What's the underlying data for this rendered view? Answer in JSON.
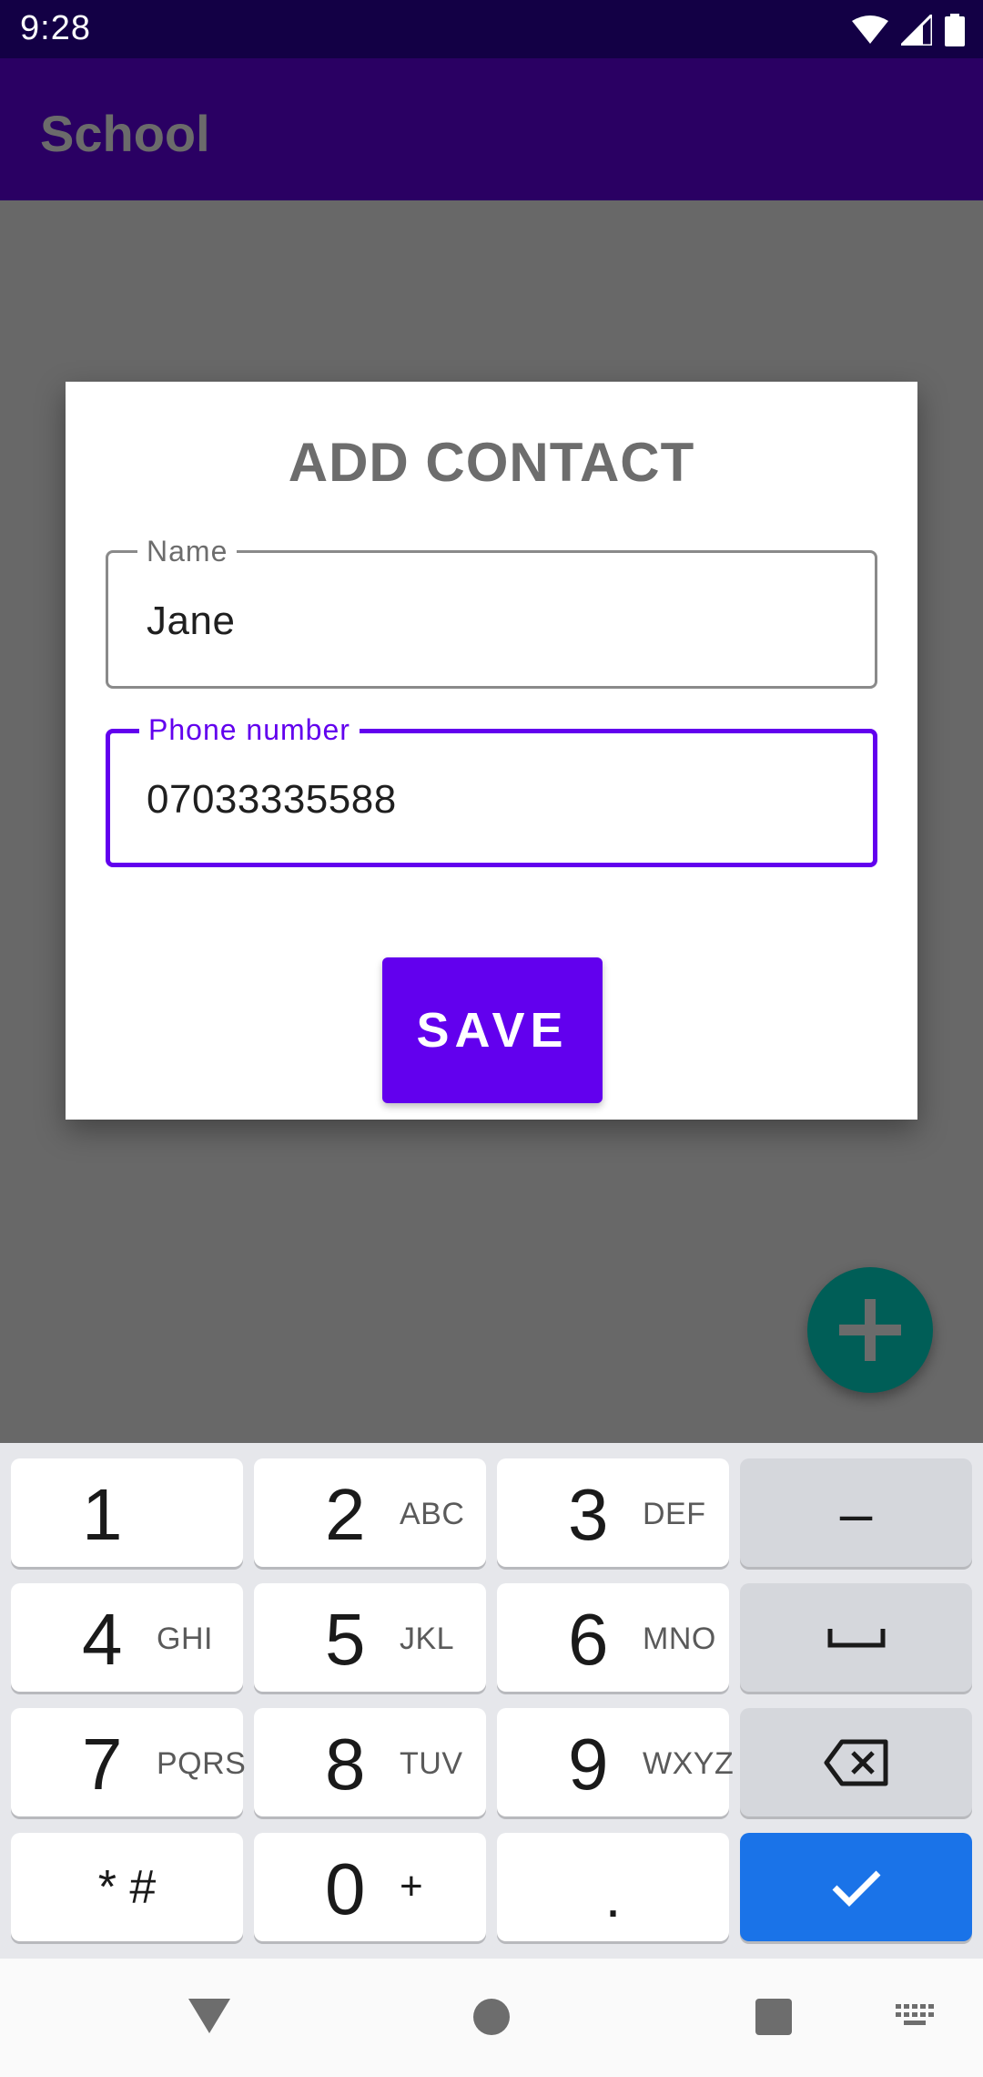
{
  "status_bar": {
    "time": "9:28",
    "icons": [
      "wifi-icon",
      "cell-signal-icon",
      "battery-icon"
    ]
  },
  "app_bar": {
    "title": "School"
  },
  "dialog": {
    "title": "ADD CONTACT",
    "name_field": {
      "label": "Name",
      "value": "Jane"
    },
    "phone_field": {
      "label": "Phone number",
      "value": "07033335588"
    },
    "save_label": "SAVE"
  },
  "fab": {
    "icon": "plus-icon"
  },
  "keyboard": {
    "rows": [
      [
        {
          "digit": "1",
          "letters": ""
        },
        {
          "digit": "2",
          "letters": "ABC"
        },
        {
          "digit": "3",
          "letters": "DEF"
        },
        {
          "symbol": "–"
        }
      ],
      [
        {
          "digit": "4",
          "letters": "GHI"
        },
        {
          "digit": "5",
          "letters": "JKL"
        },
        {
          "digit": "6",
          "letters": "MNO"
        },
        {
          "icon": "space-icon"
        }
      ],
      [
        {
          "digit": "7",
          "letters": "PQRS"
        },
        {
          "digit": "8",
          "letters": "TUV"
        },
        {
          "digit": "9",
          "letters": "WXYZ"
        },
        {
          "icon": "backspace-icon"
        }
      ],
      [
        {
          "symbol": "* #"
        },
        {
          "digit": "0",
          "letters": "+"
        },
        {
          "symbol": "."
        },
        {
          "icon": "check-icon"
        }
      ]
    ]
  },
  "nav_bar": {
    "buttons": [
      "back-icon",
      "home-icon",
      "recents-icon",
      "keyboard-switch-icon"
    ]
  },
  "colors": {
    "primary": "#6200ee",
    "app_bar": "#2a0063",
    "status_bar": "#130045",
    "fab": "#005e57",
    "enter_key": "#1a73e8"
  }
}
